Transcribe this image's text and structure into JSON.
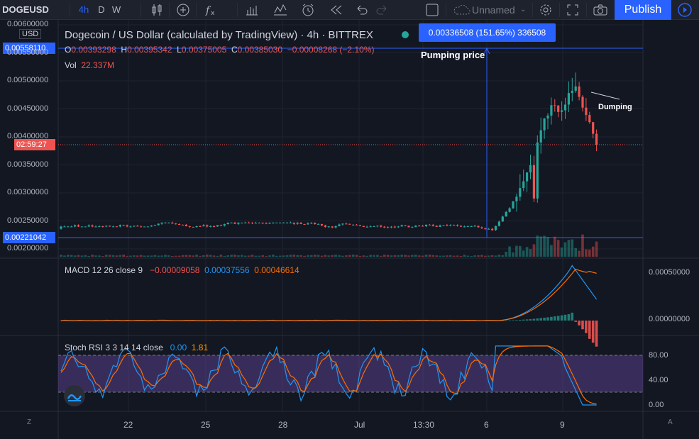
{
  "toolbar": {
    "symbol": "DOGEUSD",
    "intervals": [
      "4h",
      "D",
      "W"
    ],
    "active_interval": "4h",
    "layout_name": "Unnamed",
    "publish_label": "Publish",
    "icons": [
      "candles-icon",
      "add-indicator-icon",
      "fx-icon",
      "bar-compare-icon",
      "alerts-icon",
      "replay-icon",
      "undo-icon",
      "redo-icon",
      "fullscreen-checkbox-icon",
      "settings-gear-icon",
      "expand-icon",
      "camera-icon",
      "play-icon"
    ]
  },
  "main": {
    "title": "Dogecoin / US Dollar (calculated by TradingView) · 4h · BITTREX",
    "ohlc": {
      "o_label": "O",
      "o": "0.00393298",
      "h_label": "H",
      "h": "0.00395342",
      "l_label": "L",
      "l": "0.00375005",
      "c_label": "C",
      "c": "0.00385030",
      "change": "−0.00008268 (−2.10%)"
    },
    "vol_label": "Vol",
    "vol_value": "22.337M",
    "currency": "USD",
    "high_tag": "0.00558110",
    "low_tag": "0.00221042",
    "countdown_tag": "02:59:27",
    "measure_text": "0.00336508 (151.65%) 336508",
    "annot_pump": "Pumping price",
    "annot_dump": "Dumping",
    "y_ticks": [
      "0.00600000",
      "0.00550000",
      "0.00500000",
      "0.00450000",
      "0.00400000",
      "0.00350000",
      "0.00300000",
      "0.00250000",
      "0.00200000"
    ]
  },
  "macd": {
    "label": "MACD 12 26 close 9",
    "v1": "−0.00009058",
    "v2": "0.00037556",
    "v3": "0.00046614",
    "y_ticks": [
      "0.00050000",
      "0.00000000"
    ]
  },
  "stoch": {
    "label": "Stoch RSI 3 3 14 14 close",
    "v1": "0.00",
    "v2": "1.81",
    "y_ticks": [
      "80.00",
      "40.00",
      "0.00"
    ]
  },
  "x_axis": {
    "ticks": [
      "22",
      "25",
      "28",
      "Jul",
      "13:30",
      "6",
      "9"
    ],
    "left_btn": "Z",
    "right_btn": "A"
  },
  "colors": {
    "up": "#26a69a",
    "down": "#ef5350",
    "accent": "#2962ff",
    "macd": "#2196f3",
    "signal": "#ff6d00",
    "stoch_bg": "#7e57c2"
  }
}
